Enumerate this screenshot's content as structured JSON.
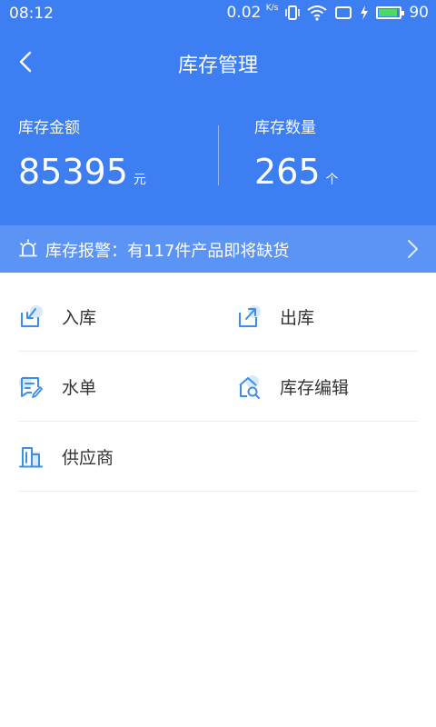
{
  "status": {
    "time": "08:12",
    "net_speed": "0.02",
    "net_unit": "K/s",
    "battery": "90",
    "battery_level": 0.9
  },
  "header": {
    "title": "库存管理"
  },
  "stats": [
    {
      "label": "库存金额",
      "value": "85395",
      "unit": "元"
    },
    {
      "label": "库存数量",
      "value": "265",
      "unit": "个"
    }
  ],
  "alert": {
    "text": "库存报警：有117件产品即将缺货"
  },
  "menu": [
    {
      "label": "入库",
      "icon": "stock-in-icon"
    },
    {
      "label": "出库",
      "icon": "stock-out-icon"
    },
    {
      "label": "水单",
      "icon": "receipt-icon"
    },
    {
      "label": "库存编辑",
      "icon": "stock-edit-icon"
    },
    {
      "label": "供应商",
      "icon": "supplier-icon"
    }
  ],
  "colors": {
    "primary": "#3d7ff2",
    "alert_bg": "#5b94f5",
    "icon": "#3d8fe6"
  }
}
